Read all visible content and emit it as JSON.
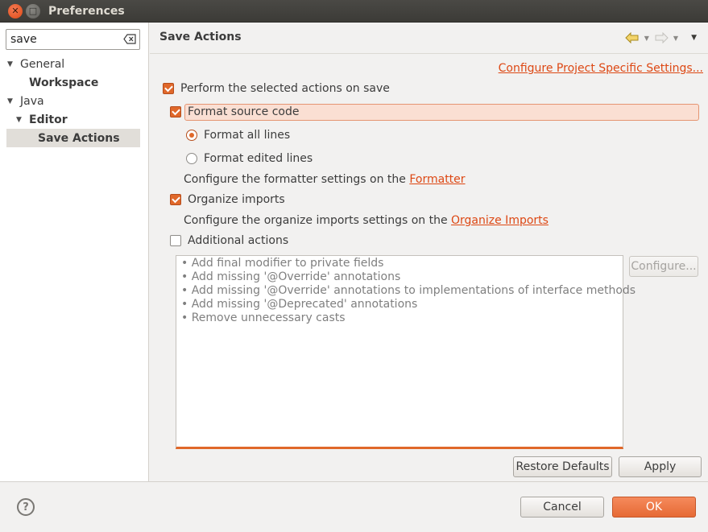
{
  "window": {
    "title": "Preferences"
  },
  "filter": {
    "value": "save"
  },
  "tree": {
    "general": "General",
    "workspace": "Workspace",
    "java": "Java",
    "editor": "Editor",
    "save_actions": "Save Actions"
  },
  "page": {
    "title": "Save Actions",
    "configure_project_link": "Configure Project Specific Settings...",
    "perform_label": "Perform the selected actions on save",
    "format_source_label": "Format source code",
    "format_all_label": "Format all lines",
    "format_edited_label": "Format edited lines",
    "formatter_text": "Configure the formatter settings on the ",
    "formatter_link": "Formatter",
    "organize_label": "Organize imports",
    "organize_text": "Configure the organize imports settings on the ",
    "organize_link": "Organize Imports",
    "additional_label": "Additional actions",
    "additional_items": [
      "• Add final modifier to private fields",
      "• Add missing '@Override' annotations",
      "• Add missing '@Override' annotations to implementations of interface methods",
      "• Add missing '@Deprecated' annotations",
      "• Remove unnecessary casts"
    ],
    "configure_button": "Configure...",
    "restore_defaults_button": "Restore Defaults",
    "apply_button": "Apply"
  },
  "footer": {
    "help_label": "?",
    "cancel_button": "Cancel",
    "ok_button": "OK"
  },
  "colors": {
    "accent": "#dd4814",
    "checkbox": "#e0682a",
    "titlebar": "#3c3b37"
  }
}
